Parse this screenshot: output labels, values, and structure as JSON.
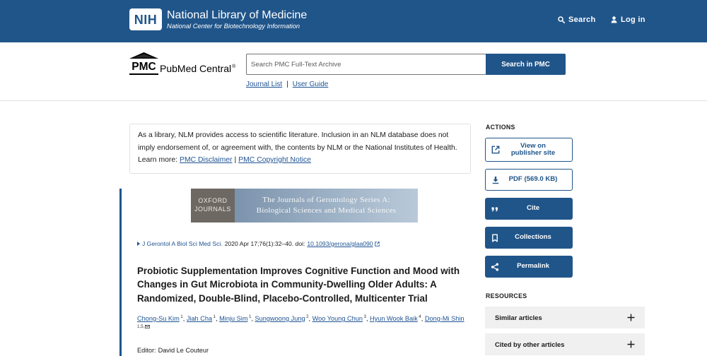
{
  "header": {
    "org_abbr": "NIH",
    "org_name": "National Library of Medicine",
    "org_subtitle": "National Center for Biotechnology Information",
    "search_label": "Search",
    "search_icon": "search-icon",
    "login_label": "Log in",
    "login_icon": "user-icon"
  },
  "pmc": {
    "logo_abbr": "PMC",
    "logo_name": "PubMed Central",
    "logo_mark": "®",
    "search_placeholder": "Search PMC Full-Text Archive",
    "search_value": "",
    "search_button": "Search in PMC",
    "links": [
      {
        "label": "Journal List"
      },
      {
        "label": "User Guide"
      }
    ],
    "link_separator": "|"
  },
  "disclaimer": {
    "text": "As a library, NLM provides access to scientific literature. Inclusion in an NLM database does not imply endorsement of, or agreement with, the contents by NLM or the National Institutes of Health.",
    "learn_more": "Learn more:",
    "links": [
      {
        "label": "PMC Disclaimer"
      },
      {
        "label": "PMC Copyright Notice"
      }
    ],
    "separator": "|"
  },
  "article": {
    "journal_banner": {
      "publisher_lines": [
        "OXFORD",
        "JOURNALS"
      ],
      "journal_lines": [
        "The Journals of Gerontology Series A:",
        "Biological Sciences and Medical Sciences"
      ]
    },
    "citation": {
      "journal": "J Gerontol A Biol Sci Med Sci.",
      "details": "2020 Apr 17;76(1):32–40. doi:",
      "doi": "10.1093/gerona/glaa090",
      "doi_icon": "external-link-icon"
    },
    "title": "Probiotic Supplementation Improves Cognitive Function and Mood with Changes in Gut Microbiota in Community-Dwelling Older Adults: A Randomized, Double-Blind, Placebo-Controlled, Multicenter Trial",
    "authors": [
      {
        "name": "Chong-Su Kim",
        "affiliation": "1"
      },
      {
        "name": "Jiah Cha",
        "affiliation": "1"
      },
      {
        "name": "Minju Sim",
        "affiliation": "1"
      },
      {
        "name": "Sungwoong Jung",
        "affiliation": "2"
      },
      {
        "name": "Woo Young Chun",
        "affiliation": "3"
      },
      {
        "name": "Hyun Wook Baik",
        "affiliation": "4"
      },
      {
        "name": "Dong-Mi Shin",
        "affiliation": "1,5,"
      }
    ],
    "author_separator": ", ",
    "corresponding_icon": "envelope-icon",
    "editor_label": "Editor:",
    "editor_name": "David Le Couteur"
  },
  "sidebar": {
    "actions_heading": "ACTIONS",
    "actions": [
      {
        "label": "View on publisher site",
        "icon": "external-link-icon"
      },
      {
        "label": "PDF (569.0 KB)",
        "icon": "download-icon"
      },
      {
        "label": "Cite",
        "icon": "quote-icon"
      },
      {
        "label": "Collections",
        "icon": "bookmark-icon"
      },
      {
        "label": "Permalink",
        "icon": "share-icon"
      }
    ],
    "resources_heading": "RESOURCES",
    "resources": [
      {
        "label": "Similar articles",
        "icon": "plus-icon"
      },
      {
        "label": "Cited by other articles",
        "icon": "plus-icon"
      }
    ]
  },
  "colors": {
    "header_background": "#20558a",
    "primary_button": "#20558a",
    "link": "#205493",
    "accordion_background": "#f0f0f0",
    "text": "#1b1b1b"
  }
}
